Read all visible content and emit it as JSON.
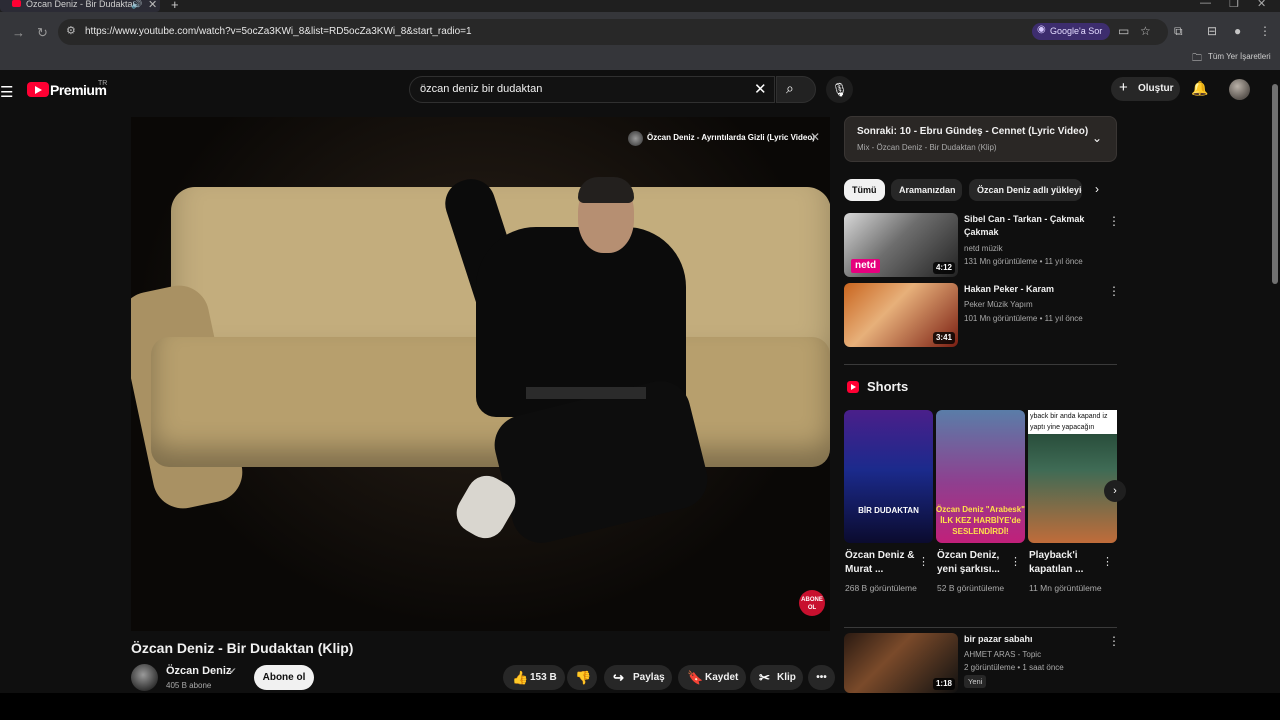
{
  "browser": {
    "tab_title": "Özcan Deniz - Bir Dudaktan",
    "url": "https://www.youtube.com/watch?v=5ocZa3KWi_8&list=RD5ocZa3KWi_8&start_radio=1",
    "google_sor": "Google'a Sor",
    "bookmarks_label": "Tüm Yer İşaretleri"
  },
  "header": {
    "logo_text": "Premium",
    "logo_region": "TR",
    "search_value": "özcan deniz bir dudaktan",
    "create_label": "Oluştur"
  },
  "player": {
    "suggestion_title": "Özcan Deniz - Ayrıntılarda Gizli (Lyric Video)",
    "watermark": "ABONE OL"
  },
  "video": {
    "title": "Özcan Deniz - Bir Dudaktan (Klip)",
    "channel": "Özcan Deniz",
    "subscribers": "405 B abone",
    "subscribe_label": "Abone ol",
    "likes": "153 B",
    "share_label": "Paylaş",
    "save_label": "Kaydet",
    "clip_label": "Klip"
  },
  "sidebar": {
    "up_next_title": "Sonraki: 10 - Ebru Gündeş - Cennet (Lyric Video)",
    "up_next_sub": "Mix - Özcan Deniz - Bir Dudaktan (Klip)",
    "chips": [
      "Tümü",
      "Aramanızdan",
      "Özcan Deniz adlı yükleyiciden"
    ],
    "related": [
      {
        "title": "Sibel Can - Tarkan - Çakmak Çakmak",
        "channel": "netd müzik",
        "meta": "131 Mn görüntüleme • 11 yıl önce",
        "duration": "4:12",
        "thumb_label": "netd"
      },
      {
        "title": "Hakan Peker - Karam",
        "channel": "Peker Müzik Yapım",
        "meta": "101 Mn görüntüleme • 11 yıl önce",
        "duration": "3:41"
      },
      {
        "title": "bir pazar sabahı",
        "channel": "AHMET ARAS - Topic",
        "meta": "2 görüntüleme • 1 saat önce",
        "duration": "1:18",
        "badge": "Yeni"
      }
    ],
    "shorts_title": "Shorts",
    "shorts": [
      {
        "title": "Özcan Deniz & Murat ...",
        "views": "268 B görüntüleme",
        "overlay": "BİR DUDAKTAN"
      },
      {
        "title": "Özcan Deniz, yeni şarkısı...",
        "views": "52 B görüntüleme",
        "overlay": "Özcan Deniz \"Arabesk\" İLK KEZ HARBİYE'de SESLENDİRDİ!"
      },
      {
        "title": "Playback'i kapatılan ...",
        "views": "11 Mn görüntüleme",
        "overlay_top": "yback bir anda kapand iz yaptı yine yapacağın"
      }
    ]
  }
}
